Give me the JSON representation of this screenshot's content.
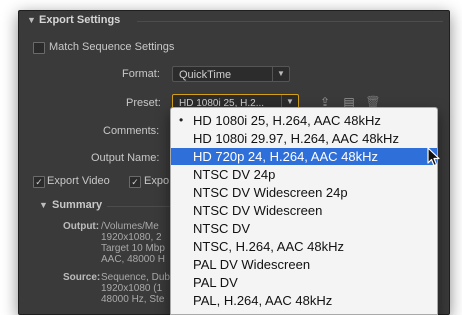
{
  "export_settings": {
    "section_title": "Export Settings",
    "match_sequence_label": "Match Sequence Settings",
    "format_label": "Format:",
    "format_value": "QuickTime",
    "preset_label": "Preset:",
    "preset_value": "HD 1080i 25, H.2...",
    "comments_label": "Comments:",
    "output_name_label": "Output Name:",
    "export_video_label": "Export Video",
    "export_audio_label_partial": "Expo",
    "export_video_checked": true,
    "export_audio_checked": true,
    "match_sequence_checked": false
  },
  "summary": {
    "title": "Summary",
    "output_label": "Output:",
    "output_lines": [
      "/Volumes/Me",
      "1920x1080, 2",
      "Target 10 Mbp",
      "AAC, 48000 H"
    ],
    "source_label": "Source:",
    "source_lines": [
      "Sequence, Dub",
      "1920x1080 (1",
      "48000 Hz, Ste"
    ]
  },
  "preset_dropdown": {
    "items": [
      {
        "label": "HD 1080i 25, H.264, AAC 48kHz",
        "checked": true,
        "selected": false
      },
      {
        "label": "HD 1080i 29.97, H.264, AAC 48kHz",
        "checked": false,
        "selected": false
      },
      {
        "label": "HD 720p 24, H.264, AAC 48kHz",
        "checked": false,
        "selected": true
      },
      {
        "label": "NTSC DV 24p",
        "checked": false,
        "selected": false
      },
      {
        "label": "NTSC DV Widescreen 24p",
        "checked": false,
        "selected": false
      },
      {
        "label": "NTSC DV Widescreen",
        "checked": false,
        "selected": false
      },
      {
        "label": "NTSC DV",
        "checked": false,
        "selected": false
      },
      {
        "label": "NTSC, H.264, AAC 48kHz",
        "checked": false,
        "selected": false
      },
      {
        "label": "PAL DV Widescreen",
        "checked": false,
        "selected": false
      },
      {
        "label": "PAL DV",
        "checked": false,
        "selected": false
      },
      {
        "label": "PAL, H.264, AAC 48kHz",
        "checked": false,
        "selected": false
      }
    ]
  },
  "icons": {
    "collapse": "triangle-down-icon",
    "save_preset": "save-preset-icon",
    "import_preset": "import-preset-icon",
    "delete_preset": "trash-icon",
    "pointer": "mouse-pointer-icon"
  },
  "colors": {
    "panel_bg": "#3a3a3a",
    "highlight": "#2f6fd9",
    "preset_focus_border": "#d4a017"
  }
}
